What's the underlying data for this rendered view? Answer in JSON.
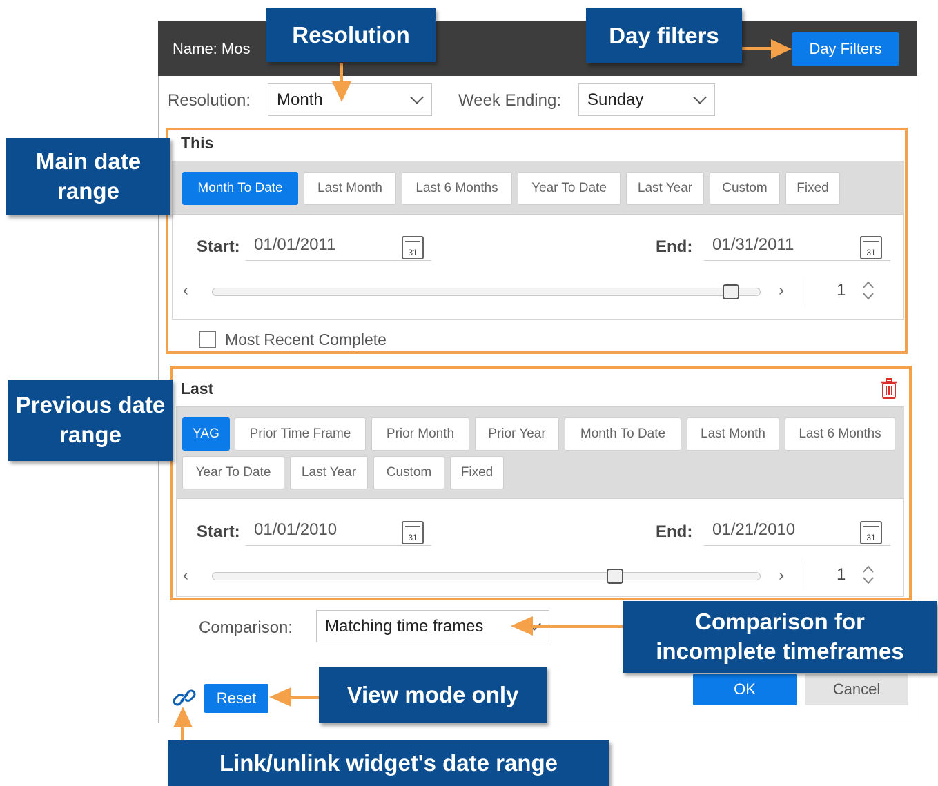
{
  "dialog": {
    "title_prefix": "Name: Mos",
    "day_filters_button": "Day Filters"
  },
  "toolbar": {
    "resolution_label": "Resolution:",
    "resolution_value": "Month",
    "week_ending_label": "Week Ending:",
    "week_ending_value": "Sunday"
  },
  "this_section": {
    "title": "This",
    "buttons": [
      "Month To Date",
      "Last Month",
      "Last 6 Months",
      "Year To Date",
      "Last Year",
      "Custom",
      "Fixed"
    ],
    "active_button": "Month To Date",
    "start_label": "Start:",
    "start_value": "01/01/2011",
    "end_label": "End:",
    "end_value": "01/31/2011",
    "calendar_day": "31",
    "slider_prev": "‹",
    "slider_next": "›",
    "slider_position": 1.0,
    "stepper_value": "1",
    "most_recent_label": "Most Recent Complete",
    "most_recent_checked": false
  },
  "last_section": {
    "title": "Last",
    "buttons_row1": [
      "YAG",
      "Prior Time Frame",
      "Prior Month",
      "Prior Year",
      "Month To Date",
      "Last Month",
      "Last 6 Months"
    ],
    "buttons_row2": [
      "Year To Date",
      "Last Year",
      "Custom",
      "Fixed"
    ],
    "active_button": "YAG",
    "start_label": "Start:",
    "start_value": "01/01/2010",
    "end_label": "End:",
    "end_value": "01/21/2010",
    "calendar_day": "31",
    "slider_prev": "‹",
    "slider_next": "›",
    "slider_position": 0.77,
    "stepper_value": "1"
  },
  "footer": {
    "comparison_label": "Comparison:",
    "comparison_value": "Matching time frames",
    "reset_button": "Reset",
    "ok_button": "OK",
    "cancel_button": "Cancel"
  },
  "callouts": {
    "resolution": "Resolution",
    "day_filters": "Day filters",
    "main_date_range": "Main date range",
    "previous_date_range": "Previous date range",
    "comparison": "Comparison for incomplete timeframes",
    "view_mode": "View mode only",
    "link": "Link/unlink widget's date range"
  },
  "colors": {
    "accent": "#0a7be8",
    "callout": "#0b4d8f",
    "highlight": "#f4a14a",
    "titlebar": "#3d3d3d",
    "delete": "#d9302c"
  }
}
